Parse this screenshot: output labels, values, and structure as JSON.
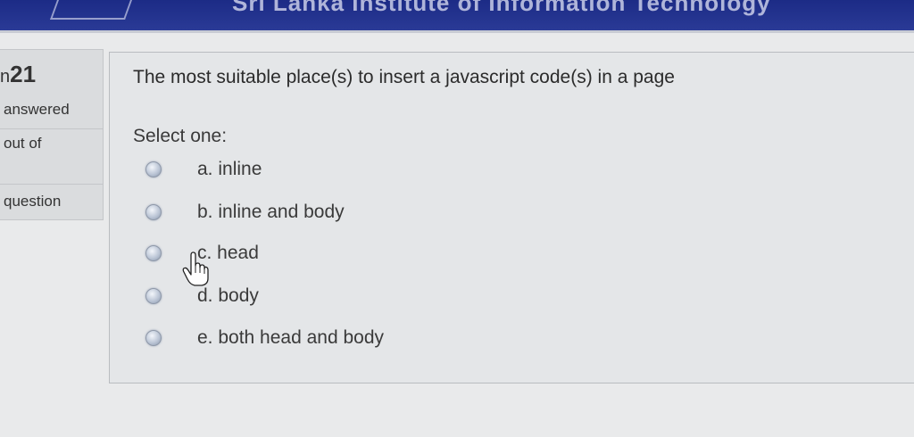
{
  "header": {
    "banner_text": "Sri Lanka Institute of Information Technology"
  },
  "info": {
    "prefix": "n",
    "number": "21",
    "status": "answered",
    "marks": "out of",
    "flag": "question"
  },
  "question": {
    "text": "The most suitable place(s) to insert a javascript code(s) in a page",
    "prompt": "Select one:",
    "options": [
      {
        "label": "a. inline"
      },
      {
        "label": "b. inline and body"
      },
      {
        "label": "c. head"
      },
      {
        "label": "d. body"
      },
      {
        "label": "e. both head and body"
      }
    ]
  },
  "colors": {
    "banner": "#1c2b86",
    "radio": "#bcc6d6"
  },
  "icons": [
    "hand-pointer-icon"
  ]
}
